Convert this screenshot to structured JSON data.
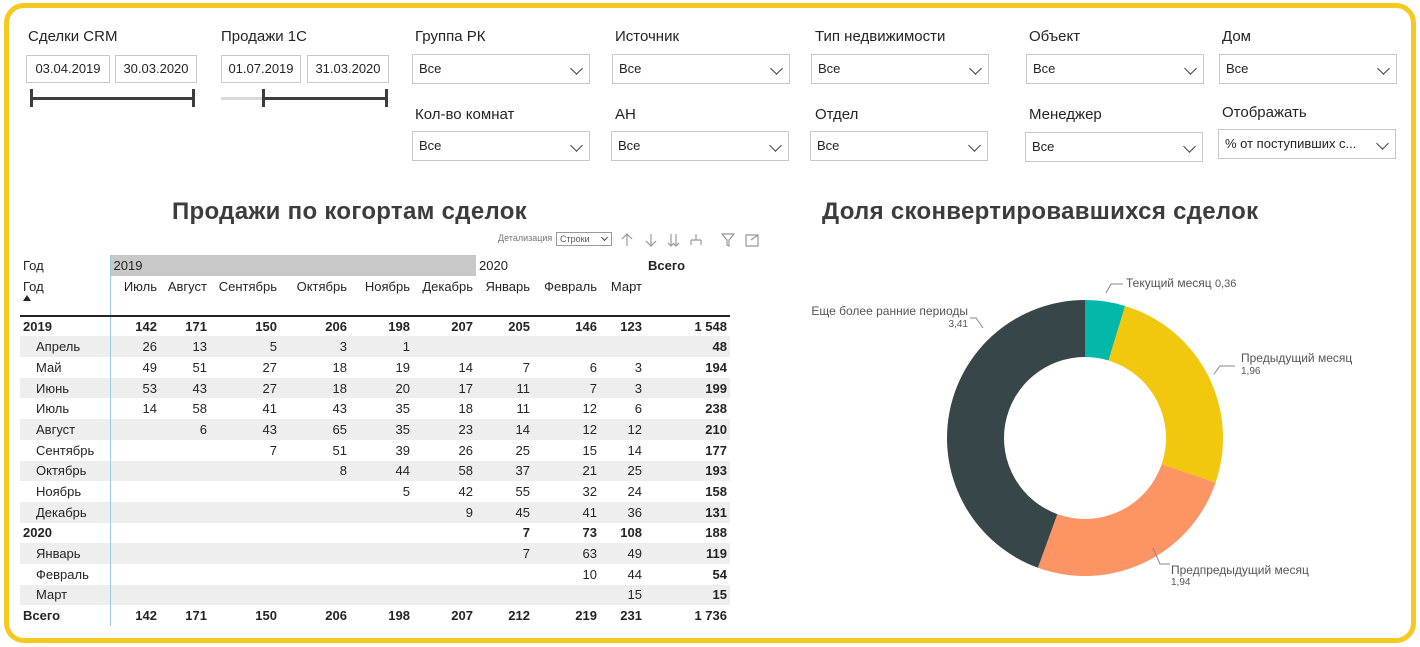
{
  "filters": {
    "crm_label": "Сделки CRM",
    "crm_from": "03.04.2019",
    "crm_to": "30.03.2020",
    "sales_label": "Продажи 1С",
    "sales_from": "01.07.2019",
    "sales_to": "31.03.2020",
    "dropdowns": [
      {
        "label": "Группа РК",
        "value": "Все"
      },
      {
        "label": "Источник",
        "value": "Все"
      },
      {
        "label": "Тип недвижимости",
        "value": "Все"
      },
      {
        "label": "Объект",
        "value": "Все"
      },
      {
        "label": "Дом",
        "value": "Все"
      },
      {
        "label": "Кол-во комнат",
        "value": "Все"
      },
      {
        "label": "АН",
        "value": "Все"
      },
      {
        "label": "Отдел",
        "value": "Все"
      },
      {
        "label": "Менеджер",
        "value": "Все"
      },
      {
        "label": "Отображать",
        "value": "% от поступивших с..."
      }
    ]
  },
  "matrix": {
    "title": "Продажи по когортам сделок",
    "drill_label": "Детализация",
    "drill_value": "Строки",
    "row_header_1": "Год",
    "row_header_2": "Год",
    "year_2019": "2019",
    "year_2020": "2020",
    "total_header": "Всего",
    "months": [
      "Июль",
      "Август",
      "Сентябрь",
      "Октябрь",
      "Ноябрь",
      "Декабрь",
      "Январь",
      "Февраль",
      "Март"
    ],
    "rows": [
      {
        "label": "2019",
        "cells": [
          "142",
          "171",
          "150",
          "206",
          "198",
          "207",
          "205",
          "146",
          "123"
        ],
        "total": "1 548",
        "level": "year"
      },
      {
        "label": "Апрель",
        "cells": [
          "26",
          "13",
          "5",
          "3",
          "1",
          "",
          "",
          "",
          ""
        ],
        "total": "48",
        "level": "month"
      },
      {
        "label": "Май",
        "cells": [
          "49",
          "51",
          "27",
          "18",
          "19",
          "14",
          "7",
          "6",
          "3"
        ],
        "total": "194",
        "level": "month"
      },
      {
        "label": "Июнь",
        "cells": [
          "53",
          "43",
          "27",
          "18",
          "20",
          "17",
          "11",
          "7",
          "3"
        ],
        "total": "199",
        "level": "month"
      },
      {
        "label": "Июль",
        "cells": [
          "14",
          "58",
          "41",
          "43",
          "35",
          "18",
          "11",
          "12",
          "6"
        ],
        "total": "238",
        "level": "month"
      },
      {
        "label": "Август",
        "cells": [
          "",
          "6",
          "43",
          "65",
          "35",
          "23",
          "14",
          "12",
          "12"
        ],
        "total": "210",
        "level": "month"
      },
      {
        "label": "Сентябрь",
        "cells": [
          "",
          "",
          "7",
          "51",
          "39",
          "26",
          "25",
          "15",
          "14"
        ],
        "total": "177",
        "level": "month"
      },
      {
        "label": "Октябрь",
        "cells": [
          "",
          "",
          "",
          "8",
          "44",
          "58",
          "37",
          "21",
          "25"
        ],
        "total": "193",
        "level": "month"
      },
      {
        "label": "Ноябрь",
        "cells": [
          "",
          "",
          "",
          "",
          "5",
          "42",
          "55",
          "32",
          "24"
        ],
        "total": "158",
        "level": "month"
      },
      {
        "label": "Декабрь",
        "cells": [
          "",
          "",
          "",
          "",
          "",
          "9",
          "45",
          "41",
          "36"
        ],
        "total": "131",
        "level": "month"
      },
      {
        "label": "2020",
        "cells": [
          "",
          "",
          "",
          "",
          "",
          "",
          "7",
          "73",
          "108"
        ],
        "total": "188",
        "level": "year"
      },
      {
        "label": "Январь",
        "cells": [
          "",
          "",
          "",
          "",
          "",
          "",
          "7",
          "63",
          "49"
        ],
        "total": "119",
        "level": "month"
      },
      {
        "label": "Февраль",
        "cells": [
          "",
          "",
          "",
          "",
          "",
          "",
          "",
          "10",
          "44"
        ],
        "total": "54",
        "level": "month"
      },
      {
        "label": "Март",
        "cells": [
          "",
          "",
          "",
          "",
          "",
          "",
          "",
          "",
          "15"
        ],
        "total": "15",
        "level": "month"
      },
      {
        "label": "Всего",
        "cells": [
          "142",
          "171",
          "150",
          "206",
          "198",
          "207",
          "212",
          "219",
          "231"
        ],
        "total": "1 736",
        "level": "total"
      }
    ]
  },
  "donut": {
    "title": "Доля сконвертировавшихся сделок",
    "chart_data": {
      "type": "pie",
      "categories": [
        "Текущий месяц",
        "Предыдущий месяц",
        "Предпредыдущий месяц",
        "Еще более ранние периоды"
      ],
      "values": [
        0.36,
        1.96,
        1.94,
        3.41
      ],
      "colors": [
        "#01B8AA",
        "#F2C80F",
        "#FD9464",
        "#374649"
      ]
    },
    "labels": [
      {
        "name": "Текущий месяц",
        "value": "0,36"
      },
      {
        "name": "Предыдущий месяц",
        "value": "1,96"
      },
      {
        "name": "Предпредыдущий месяц",
        "value": "1,94"
      },
      {
        "name": "Еще более ранние периоды",
        "value": "3,41"
      }
    ]
  }
}
